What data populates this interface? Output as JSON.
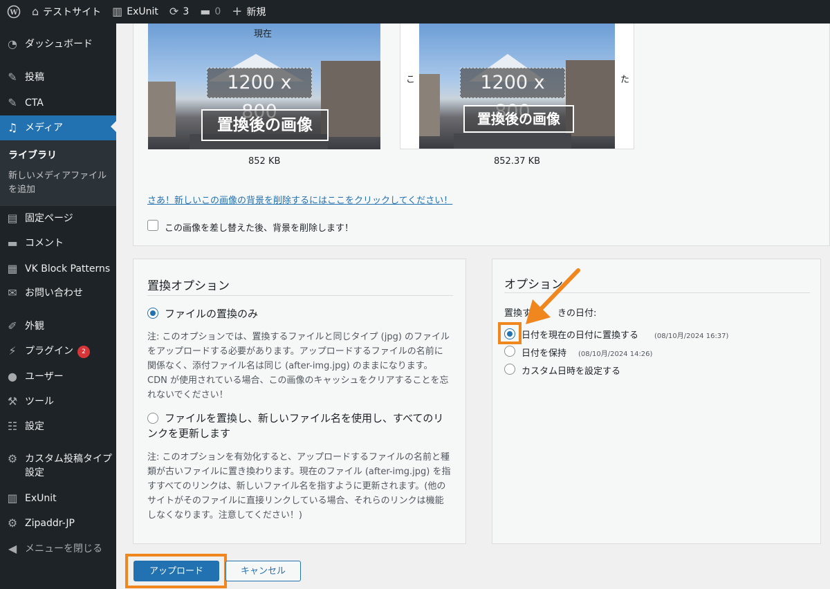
{
  "adminbar": {
    "wp_icon": "wordpress-logo-icon",
    "site_name": "テストサイト",
    "exunit": "ExUnit",
    "updates_count": "3",
    "comments_count": "0",
    "new_label": "新規"
  },
  "sidebar": {
    "items": [
      {
        "label": "ダッシュボード",
        "icon": "dashboard-icon"
      },
      {
        "label": "投稿",
        "icon": "pin-icon"
      },
      {
        "label": "CTA",
        "icon": "pin-icon"
      },
      {
        "label": "メディア",
        "icon": "media-icon"
      },
      {
        "label": "固定ページ",
        "icon": "page-icon"
      },
      {
        "label": "コメント",
        "icon": "comment-icon"
      },
      {
        "label": "VK Block Patterns",
        "icon": "grid-icon"
      },
      {
        "label": "お問い合わせ",
        "icon": "mail-icon"
      },
      {
        "label": "外観",
        "icon": "brush-icon"
      },
      {
        "label": "プラグイン",
        "icon": "plugin-icon",
        "badge": "2"
      },
      {
        "label": "ユーザー",
        "icon": "user-icon"
      },
      {
        "label": "ツール",
        "icon": "wrench-icon"
      },
      {
        "label": "設定",
        "icon": "settings-icon"
      },
      {
        "label": "カスタム投稿タイプ設定",
        "icon": "gear-icon"
      },
      {
        "label": "ExUnit",
        "icon": "exunit-icon"
      },
      {
        "label": "Zipaddr-JP",
        "icon": "gear-icon"
      },
      {
        "label": "メニューを閉じる",
        "icon": "collapse-icon"
      }
    ],
    "submenu": {
      "library": "ライブラリ",
      "add_new": "新しいメディアファイルを追加"
    }
  },
  "preview": {
    "current_label": "現在",
    "current_size_overlay": "1200 x 800",
    "current_text_overlay": "置換後の画像",
    "current_filesize": "852 KB",
    "new_left_text": "こ",
    "new_right_text": "た",
    "new_size_overlay": "1200 x 800",
    "new_text_overlay": "置換後の画像",
    "new_filesize": "852.37 KB",
    "remove_bg_link": "さあ！新しいこの画像の背景を削除するにはここをクリックしてください！",
    "remove_bg_checkbox": "この画像を差し替えた後、背景を削除します！"
  },
  "replace_options": {
    "title": "置換オプション",
    "option1_label": "ファイルの置換のみ",
    "option1_note": "注: このオプションでは、置換するファイルと同じタイプ (jpg) のファイルをアップロードする必要があります。アップロードするファイルの名前に関係なく、添付ファイル名は同じ (after-img.jpg) のままになります。CDN が使用されている場合、この画像のキャッシュをクリアすることを忘れないでください！",
    "option2_label": "ファイルを置換し、新しいファイル名を使用し、すべてのリンクを更新します",
    "option2_note": "注: このオプションを有効化すると、アップロードするファイルの名前と種類が古いファイルに置き換わります。現在のファイル (after-img.jpg) を指すすべてのリンクは、新しいファイル名を指すように更新されます。(他のサイトがそのファイルに直接リンクしている場合、それらのリンクは機能しなくなります。注意してください！)",
    "option1_selected": true
  },
  "options": {
    "title_visible": "オプション",
    "date_label_left": "置換す",
    "date_label_right": "きの日付:",
    "date_choices": [
      {
        "label": "日付を現在の日付に置換する",
        "meta": "(08/10月/2024 16:37)",
        "selected": true
      },
      {
        "label": "日付を保持",
        "meta": "(08/10月/2024 14:26)",
        "selected": false
      },
      {
        "label": "カスタム日時を設定する",
        "meta": "",
        "selected": false
      }
    ]
  },
  "actions": {
    "upload": "アップロード",
    "cancel": "キャンセル"
  },
  "colors": {
    "accent": "#2271b1",
    "highlight": "#f0861e",
    "adminbar": "#1d2327"
  }
}
